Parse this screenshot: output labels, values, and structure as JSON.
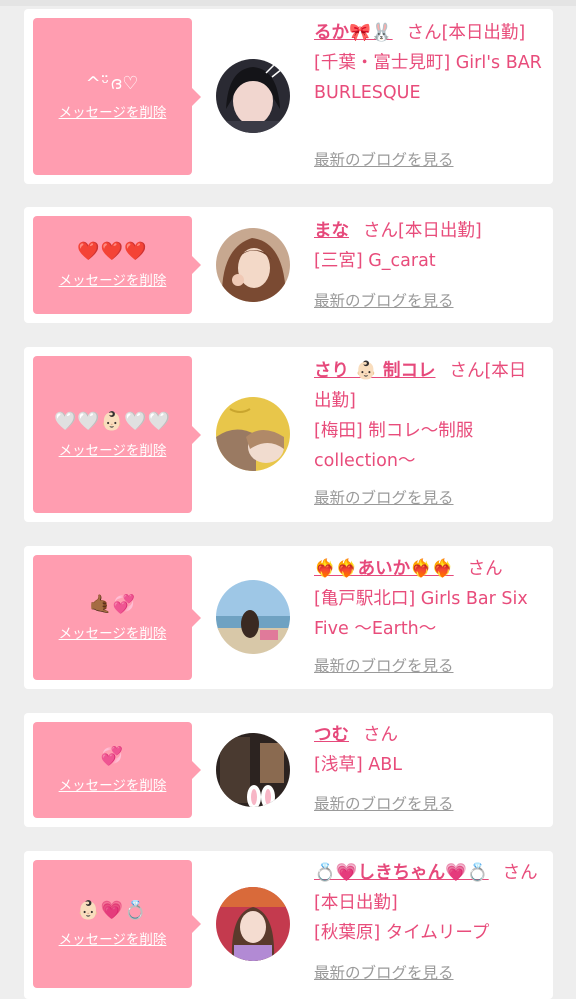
{
  "labels": {
    "delete_message": "メッセージを削除",
    "latest_blog": "最新のブログを見る",
    "san": "さん"
  },
  "colors": {
    "page_bg": "#eeeeee",
    "card_bg": "#ffffff",
    "bubble_bg": "#ff9db0",
    "name_pink": "#e6497b",
    "link_gray": "#9a9a9a"
  },
  "entries": [
    {
      "message": "^ᵕ̈ദ♡",
      "name": "るか🎀🐰",
      "status": "[本日出勤]",
      "shop": "[千葉・富士見町] Girl's BAR BURLESQUE",
      "avatar_icon": "avatar-photo-icon"
    },
    {
      "message": "❤️❤️❤️",
      "name": "まな",
      "status": "[本日出勤]",
      "shop": "[三宮] G_carat",
      "avatar_icon": "avatar-photo-icon"
    },
    {
      "message": "🤍🤍👶🏻🤍🤍",
      "name": "さり 👶🏻 制コレ",
      "status": "[本日出勤]",
      "shop": "[梅田] 制コレ〜制服collection〜",
      "avatar_icon": "avatar-photo-icon"
    },
    {
      "message": "🤙🏾💞",
      "name": "❤️‍🔥❤️‍🔥あいか❤️‍🔥❤️‍🔥",
      "status": "",
      "shop": "[亀戸駅北口] Girls Bar Six Five 〜Earth〜",
      "avatar_icon": "avatar-photo-icon"
    },
    {
      "message": "💞",
      "name": "つむ",
      "status": "",
      "shop": "[浅草] ABL",
      "avatar_icon": "avatar-photo-icon"
    },
    {
      "message": "👶🏻💗💍",
      "name": "💍💗しきちゃん💗💍",
      "status": "[本日出勤]",
      "shop": "[秋葉原] タイムリープ",
      "avatar_icon": "avatar-photo-icon"
    }
  ]
}
